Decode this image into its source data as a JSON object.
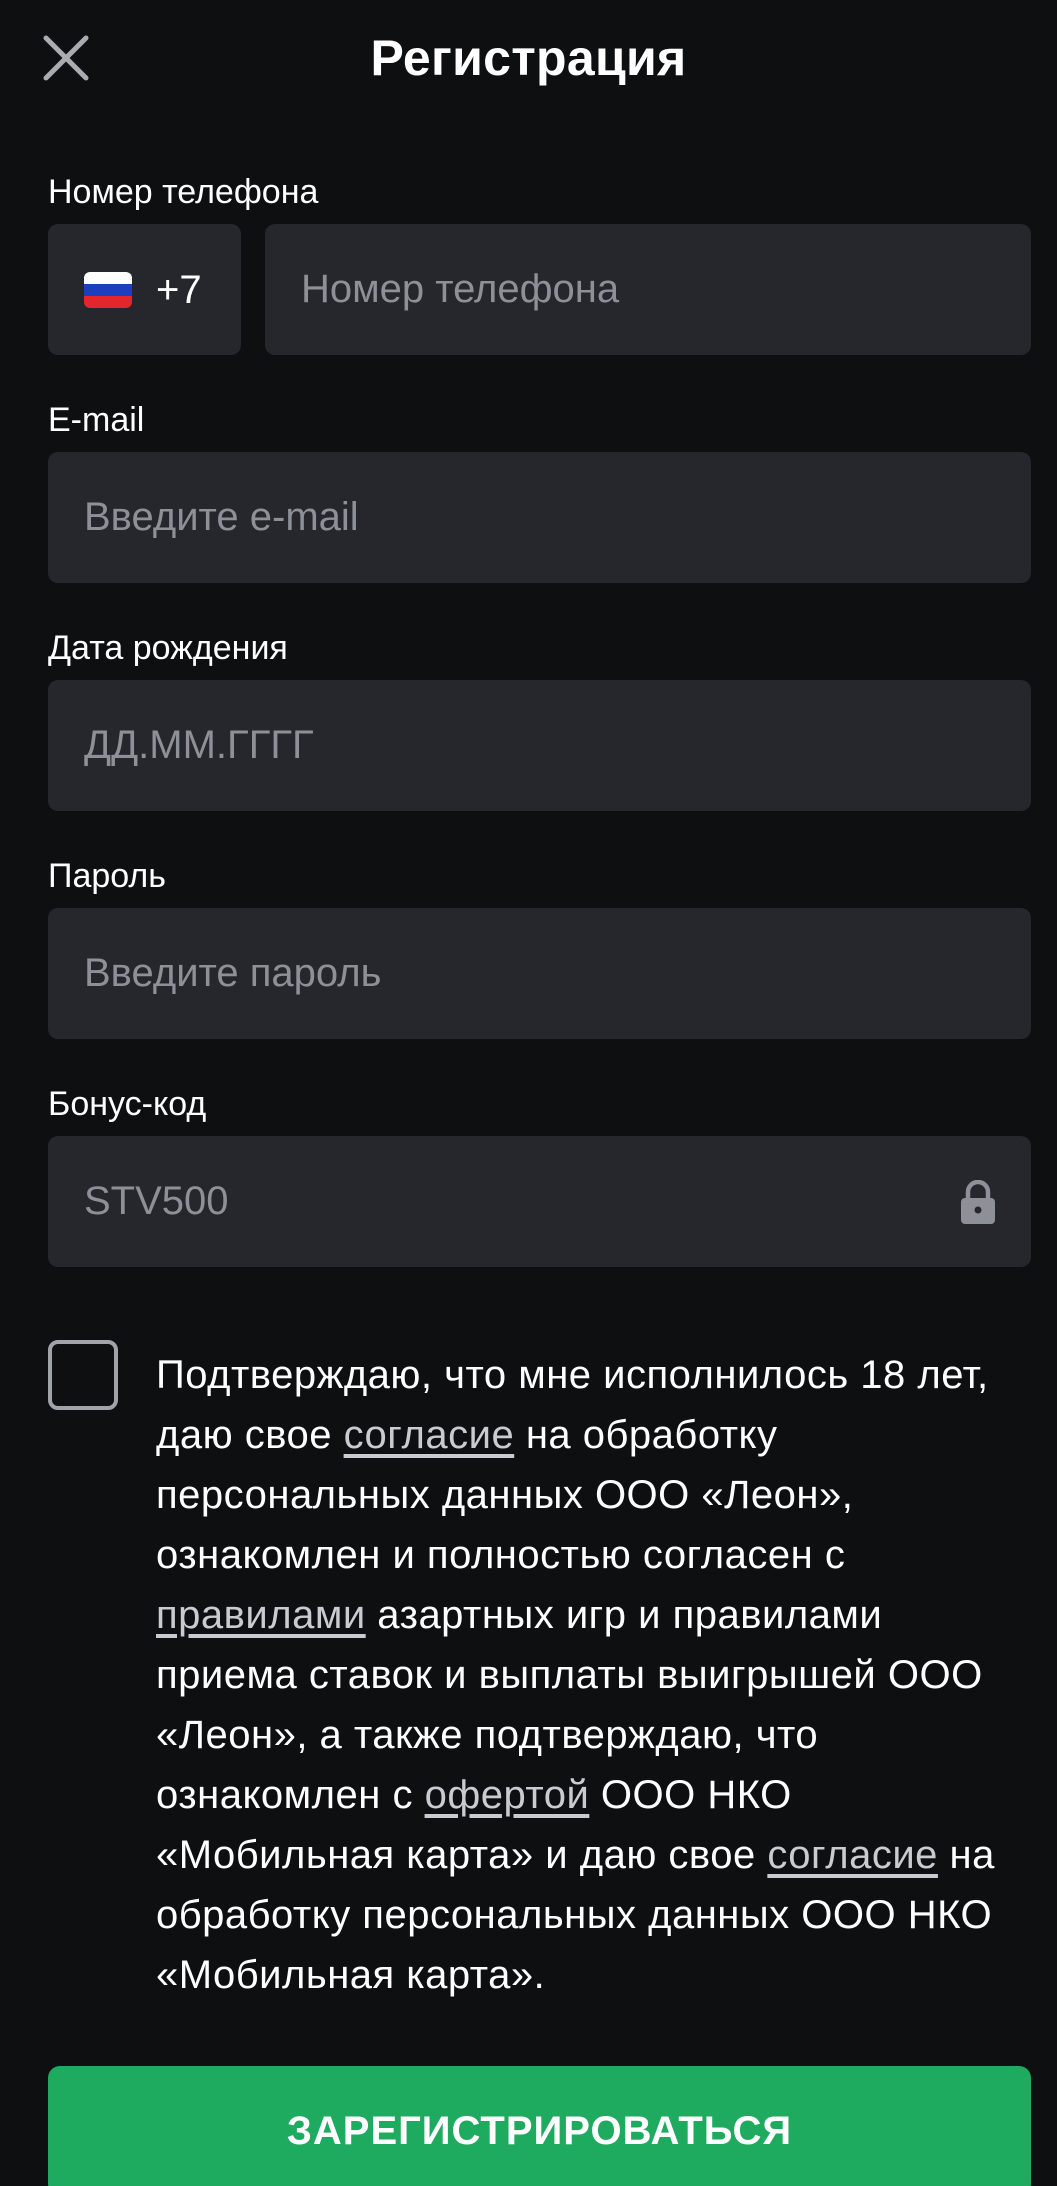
{
  "header": {
    "title": "Регистрация",
    "close_icon": "close-icon"
  },
  "phone": {
    "label": "Номер телефона",
    "country_code": "+7",
    "country_flag": "russia-flag-icon",
    "placeholder": "Номер телефона",
    "value": ""
  },
  "email": {
    "label": "E-mail",
    "placeholder": "Введите e-mail",
    "value": ""
  },
  "birthdate": {
    "label": "Дата рождения",
    "placeholder": "ДД.ММ.ГГГГ",
    "value": ""
  },
  "password": {
    "label": "Пароль",
    "placeholder": "Введите пароль",
    "value": ""
  },
  "bonus": {
    "label": "Бонус-код",
    "value": "STV500",
    "locked_icon": "lock-icon"
  },
  "consent": {
    "checked": false,
    "text_1": "Подтверждаю, что мне исполнилось 18 лет, даю свое ",
    "link_1": "согласие",
    "text_2": " на обработку персональных данных ООО «Леон», ознакомлен и полностью согласен с ",
    "link_2": "правилами",
    "text_3": " азартных игр и правилами приема ставок и выплаты выигрышей ООО «Леон», а также подтверждаю, что ознакомлен с ",
    "link_3": "офертой",
    "text_4": " ООО НКО «Мобильная карта» и даю свое ",
    "link_4": "согласие",
    "text_5": " на обработку персональных данных ООО НКО «Мобильная карта»."
  },
  "submit": {
    "label": "ЗАРЕГИСТРИРОВАТЬСЯ"
  },
  "colors": {
    "background": "#0e0f11",
    "field": "#25272c",
    "placeholder": "#8d9096",
    "accent": "#1fab5f"
  }
}
